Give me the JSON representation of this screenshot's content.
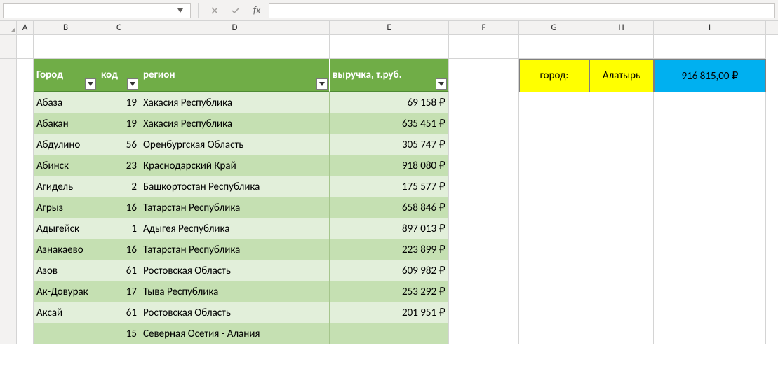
{
  "formula_bar": {
    "name_box_value": "",
    "fx_label": "fx",
    "formula_value": ""
  },
  "column_headers": [
    "A",
    "B",
    "C",
    "D",
    "E",
    "F",
    "G",
    "H",
    "I"
  ],
  "table": {
    "headers": {
      "city": "Город",
      "code": "код",
      "region": "регион",
      "revenue": "выручка, т.руб."
    },
    "rows": [
      {
        "city": "Абаза",
        "code": "19",
        "region": "Хакасия Республика",
        "revenue": "69 158 ₽"
      },
      {
        "city": "Абакан",
        "code": "19",
        "region": "Хакасия Республика",
        "revenue": "635 451 ₽"
      },
      {
        "city": "Абдулино",
        "code": "56",
        "region": "Оренбургская Область",
        "revenue": "305 747 ₽"
      },
      {
        "city": "Абинск",
        "code": "23",
        "region": "Краснодарский Край",
        "revenue": "918 080 ₽"
      },
      {
        "city": "Агидель",
        "code": "2",
        "region": "Башкортостан Республика",
        "revenue": "175 577 ₽"
      },
      {
        "city": "Агрыз",
        "code": "16",
        "region": "Татарстан Республика",
        "revenue": "658 846 ₽"
      },
      {
        "city": "Адыгейск",
        "code": "1",
        "region": "Адыгея Республика",
        "revenue": "897 013 ₽"
      },
      {
        "city": "Азнакаево",
        "code": "16",
        "region": "Татарстан Республика",
        "revenue": "223 899 ₽"
      },
      {
        "city": "Азов",
        "code": "61",
        "region": "Ростовская Область",
        "revenue": "609 982 ₽"
      },
      {
        "city": "Ак-Довурак",
        "code": "17",
        "region": "Тыва Республика",
        "revenue": "253 292 ₽"
      },
      {
        "city": "Аксай",
        "code": "61",
        "region": "Ростовская Область",
        "revenue": "201 951 ₽"
      },
      {
        "city": "",
        "code": "15",
        "region": "Северная Осетия - Алания",
        "revenue": ""
      }
    ]
  },
  "lookup": {
    "label": "город:",
    "city": "Алатырь",
    "value": "916 815,00 ₽"
  },
  "colors": {
    "yellow": "#FFFF00",
    "blue": "#00B0F0",
    "table_header": "#70AD47"
  }
}
